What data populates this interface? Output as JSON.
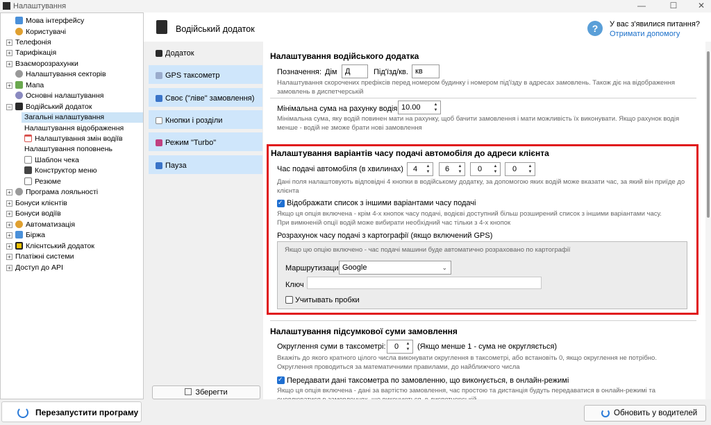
{
  "window": {
    "title": "Налаштування"
  },
  "tree": {
    "items": [
      {
        "label": "Мова інтерфейсу",
        "icon": "language-icon",
        "color": "#4a90d9"
      },
      {
        "label": "Користувачі",
        "icon": "users-icon",
        "color": "#e0a030"
      },
      {
        "label": "Телефонія",
        "icon": "phone-icon",
        "color": ""
      },
      {
        "label": "Тарифікація",
        "icon": "tariff-icon",
        "color": ""
      },
      {
        "label": "Взаєморозрахунки",
        "icon": "settlements-icon",
        "color": ""
      },
      {
        "label": "Налаштування секторів",
        "icon": "sectors-icon",
        "color": "#999999"
      },
      {
        "label": "Мапа",
        "icon": "map-icon",
        "color": "#6aa84f"
      },
      {
        "label": "Основні налаштування",
        "icon": "gear-icon",
        "color": "#8a8ac0"
      },
      {
        "label": "Водійський додаток",
        "icon": "driver-app-icon",
        "color": "#2b2b2b"
      },
      {
        "label": "Загальні налаштування",
        "icon": "",
        "color": ""
      },
      {
        "label": "Налаштування відображення",
        "icon": "",
        "color": ""
      },
      {
        "label": "Налаштування змін водіїв",
        "icon": "calendar-icon",
        "color": "#d9534f"
      },
      {
        "label": "Налаштування поповнень",
        "icon": "",
        "color": ""
      },
      {
        "label": "Шаблон чека",
        "icon": "receipt-icon",
        "color": "#888888"
      },
      {
        "label": "Конструктор меню",
        "icon": "menu-builder-icon",
        "color": "#444444"
      },
      {
        "label": "Резюме",
        "icon": "resume-icon",
        "color": "#777777"
      },
      {
        "label": "Програма лояльності",
        "icon": "loyalty-icon",
        "color": "#999999"
      },
      {
        "label": "Бонуси клієнтів",
        "icon": "",
        "color": ""
      },
      {
        "label": "Бонуси водіїв",
        "icon": "",
        "color": ""
      },
      {
        "label": "Автоматизація",
        "icon": "automation-icon",
        "color": "#e0a030"
      },
      {
        "label": "Біржа",
        "icon": "exchange-icon",
        "color": "#4a90d9"
      },
      {
        "label": "Клієнтський додаток",
        "icon": "client-app-icon",
        "color": "#f2c200"
      },
      {
        "label": "Платіжні системи",
        "icon": "",
        "color": ""
      },
      {
        "label": "Доступ до API",
        "icon": "",
        "color": ""
      }
    ]
  },
  "restart_label": "Перезапустити програму",
  "header": {
    "title": "Водійський додаток",
    "help_q": "?",
    "help_line1": "У вас з'явилися питання?",
    "help_line2": "Отримати допомогу"
  },
  "tabs": [
    {
      "label": "Додаток",
      "icon": "app-icon"
    },
    {
      "label": "GPS таксометр",
      "icon": "gps-icon"
    },
    {
      "label": "Своє (\"ліве\" замовлення)",
      "icon": "own-order-icon"
    },
    {
      "label": "Кнопки і розділи",
      "icon": "buttons-icon"
    },
    {
      "label": "Режим \"Turbo\"",
      "icon": "turbo-icon"
    },
    {
      "label": "Пауза",
      "icon": "pause-icon"
    }
  ],
  "save_label": "Зберегти",
  "s1": {
    "title": "Налаштування водійського додатка",
    "label": "Позначення:",
    "house_label": "Дім",
    "house_value": "Д",
    "entrance_label": "Під'їзд/кв.",
    "entrance_value": "кв",
    "hint": "Налаштування скорочених префіксів перед номером будинку і номером під'їзду в адресах замовлень. Також діє на відображення замовлень в диспетчерській",
    "min_label": "Мінімальна сума на рахунку водія",
    "min_value": "10.00",
    "min_hint": "Мінімальна сума, яку водій повинен мати на рахунку, щоб бачити замовлення і мати можливість їх виконувати. Якщо рахунок водія менше - водій не зможе брати нові замовлення"
  },
  "s2": {
    "title": "Налаштування варіантів часу подачі автомобіля до адреси клієнта",
    "time_label": "Час подачі автомобіля (в хвилинах)",
    "times": [
      "4",
      "6",
      "0",
      "0"
    ],
    "time_hint": "Дані поля налаштовують відповідні 4 кнопки в водійському додатку, за допомогою яких водій може вказати час, за який він приїде до клієнта",
    "show_list_label": "Відображати список з іншими варіантами часу подачі",
    "show_list_hint": "Якщо ця опція включена - крім 4-х кнопок часу подачі, водієві доступний більш розширений список з іншими варіантами часу. При вимкненій опції водій може вибирати необхідний час тільки з 4-х кнопок",
    "calc_label": "Розрахунок часу подачі з картографії (якщо включений GPS)",
    "gps_hint": "Якщо цю опцію включено - час подачі машини буде автоматично розраховано по картографії",
    "routing_label": "Маршрутизация",
    "routing_value": "Google",
    "key_label": "Ключ",
    "key_value": "",
    "traffic_label": "Учитывать пробки"
  },
  "s3": {
    "title": "Налаштування підсумкової суми замовлення",
    "round_label": "Округлення суми в таксометрі:",
    "round_value": "0",
    "round_note": "(Якщо менше 1 - сума не округляється)",
    "round_hint": "Вкажіть до якого кратного цілого числа виконувати округлення в таксометрі, або встановіть 0, якщо округлення не потрібно. Округлення проводиться за математичними правилами, до найближчого числа",
    "send_label": "Передавати дані таксометра по замовленню, що виконується,  в онлайн-режимі",
    "send_hint": "Якщо ця опція включена - дані за вартістю замовлення, час простою та дистанція будуть передаватися в онлайн-режимі та оновлюватися в замовленнях, що виконуються, в диспетчерській"
  },
  "update_label": "Обновить у водителей",
  "colors": {
    "accent": "#1f6fd1",
    "highlight": "#e0161a",
    "tab_bg": "#cfe6fb",
    "selected": "#cce4f7"
  }
}
